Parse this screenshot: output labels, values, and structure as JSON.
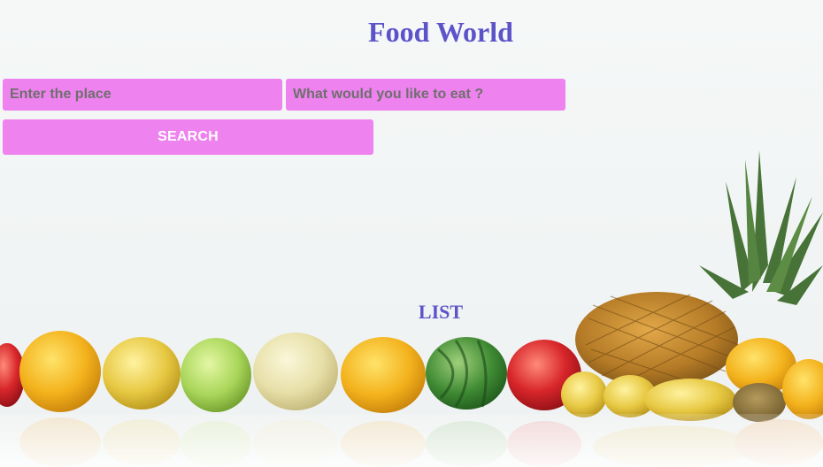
{
  "header": {
    "title": "Food World"
  },
  "search": {
    "place_placeholder": "Enter the place",
    "food_placeholder": "What would you like to eat ?",
    "button_label": "SEARCH"
  },
  "list": {
    "heading": "LIST"
  },
  "colors": {
    "title_text": "#5d53c9",
    "field_background": "#ee82ee",
    "button_text": "#ffffff",
    "page_background": "#f4f6f6"
  },
  "background_image": {
    "icon": "fruit-row-photo"
  }
}
